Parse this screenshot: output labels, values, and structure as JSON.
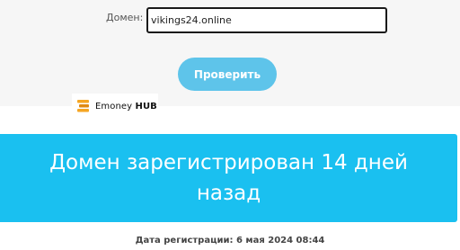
{
  "form": {
    "domain_label": "Домен:",
    "domain_value": "vikings24.online",
    "check_button_label": "Проверить"
  },
  "logo": {
    "name_part1": "Emoney ",
    "name_part2": "HUB"
  },
  "result": {
    "message": "Домен зарегистрирован 14 дней назад",
    "registration_date": "Дата регистрации: 6 мая 2024 08:44"
  },
  "colors": {
    "accent_button": "#5ec4ea",
    "banner": "#1ac0f0",
    "panel_bg": "#f6f6f6"
  }
}
